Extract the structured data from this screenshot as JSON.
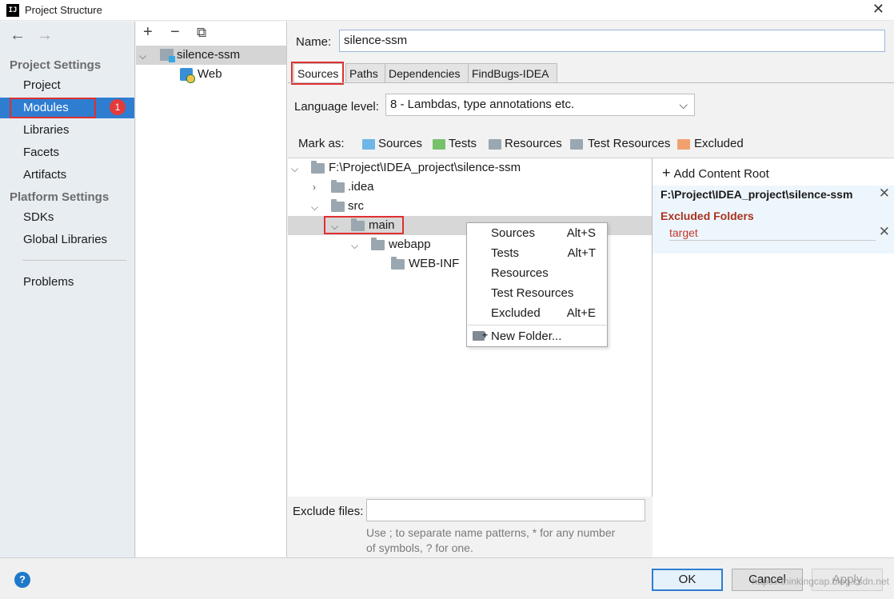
{
  "window": {
    "title": "Project Structure",
    "logo": "IJ"
  },
  "nav": {
    "back_icon": "←",
    "forward_icon": "→",
    "project_settings": "Project Settings",
    "items_project": [
      "Project",
      "Modules",
      "Libraries",
      "Facets",
      "Artifacts"
    ],
    "platform_settings": "Platform Settings",
    "items_platform": [
      "SDKs",
      "Global Libraries"
    ],
    "problems": "Problems",
    "badge": "1"
  },
  "modules": {
    "add": "+",
    "remove": "−",
    "copy": "⧉",
    "tree": [
      "silence-ssm",
      "Web"
    ]
  },
  "module_settings": {
    "name_label": "Name:",
    "name_value": "silence-ssm",
    "tabs": [
      "Sources",
      "Paths",
      "Dependencies",
      "FindBugs-IDEA"
    ],
    "language_label": "Language level:",
    "language_value": "8 - Lambdas, type annotations etc.",
    "mark_as_label": "Mark as:",
    "mark_as": [
      {
        "label": "Sources",
        "color": "#6fb5e6"
      },
      {
        "label": "Tests",
        "color": "#76c26a"
      },
      {
        "label": "Resources",
        "color": "#9aa7b0"
      },
      {
        "label": "Test Resources",
        "color": "#9aa7b0"
      },
      {
        "label": "Excluded",
        "color": "#f2a070"
      }
    ]
  },
  "content_tree": {
    "root": "F:\\Project\\IDEA_project\\silence-ssm",
    "nodes": [
      ".idea",
      "src",
      "main",
      "webapp",
      "WEB-INF"
    ]
  },
  "context_menu": [
    {
      "label": "Sources",
      "shortcut": "Alt+S"
    },
    {
      "label": "Tests",
      "shortcut": "Alt+T"
    },
    {
      "label": "Resources",
      "shortcut": ""
    },
    {
      "label": "Test Resources",
      "shortcut": ""
    },
    {
      "label": "Excluded",
      "shortcut": "Alt+E"
    },
    {
      "label": "New Folder...",
      "shortcut": ""
    }
  ],
  "exclude": {
    "label": "Exclude files:",
    "hint_line1": "Use ; to separate name patterns, * for any number",
    "hint_line2": "of symbols, ? for one."
  },
  "content_roots": {
    "add_label": "Add Content Root",
    "root_path": "F:\\Project\\IDEA_project\\silence-ssm",
    "excluded_header": "Excluded Folders",
    "excluded_items": [
      "target"
    ]
  },
  "footer": {
    "help": "?",
    "ok": "OK",
    "cancel": "Cancel",
    "apply": "Apply",
    "watermark": "https://thinkingcap.blog.csdn.net"
  }
}
